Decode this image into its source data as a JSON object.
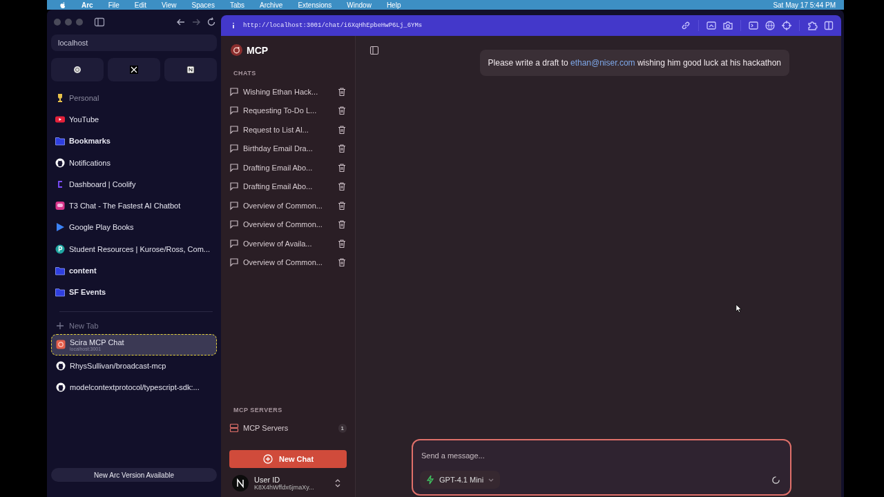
{
  "menu_bar": {
    "app": "Arc",
    "items": [
      "File",
      "Edit",
      "View",
      "Spaces",
      "Tabs",
      "Archive",
      "Extensions",
      "Window",
      "Help"
    ],
    "clock": "Sat May 17  5:44 PM"
  },
  "arc_sidebar": {
    "address": "localhost",
    "items": [
      {
        "kind": "space",
        "label": "Personal"
      },
      {
        "kind": "youtube",
        "label": "YouTube"
      },
      {
        "kind": "folder",
        "label": "Bookmarks"
      },
      {
        "kind": "github",
        "label": "Notifications"
      },
      {
        "kind": "coolify",
        "label": "Dashboard | Coolify"
      },
      {
        "kind": "t3",
        "label": "T3 Chat - The Fastest AI Chatbot"
      },
      {
        "kind": "play",
        "label": "Google Play Books"
      },
      {
        "kind": "pearson",
        "label": "Student Resources | Kurose/Ross, Com..."
      },
      {
        "kind": "folder",
        "label": "content"
      },
      {
        "kind": "folder",
        "label": "SF Events"
      }
    ],
    "new_tab": "New Tab",
    "tabs": [
      {
        "kind": "scira",
        "title": "Scira MCP Chat",
        "subtitle": "localhost:3001",
        "selected": true
      },
      {
        "kind": "github",
        "title": "RhysSullivan/broadcast-mcp",
        "selected": false
      },
      {
        "kind": "github",
        "title": "modelcontextprotocol/typescript-sdk:...",
        "selected": false
      }
    ],
    "update_banner": "New Arc Version Available"
  },
  "browser": {
    "url": "http://localhost:3001/chat/i6XqHhEpbeHwP6Lj_6YMs"
  },
  "app": {
    "brand": "MCP",
    "chats_heading": "CHATS",
    "chats": [
      "Wishing Ethan Hack...",
      "Requesting To-Do L...",
      "Request to List Al...",
      "Birthday Email Dra...",
      "Drafting Email Abo...",
      "Drafting Email Abo...",
      "Overview of Common...",
      "Overview of Common...",
      "Overview of Availa...",
      "Overview of Common..."
    ],
    "servers_heading": "MCP SERVERS",
    "servers": {
      "label": "MCP Servers",
      "count": "1"
    },
    "new_chat": "New Chat",
    "user": {
      "name": "User ID",
      "id": "K8X4hWffdx6jmaXy..."
    },
    "message": {
      "before": "Please write a draft to",
      "link": "ethan@niser.com",
      "after": "wishing him good luck at his hackathon"
    },
    "composer": {
      "placeholder": "Send a message...",
      "model": "GPT-4.1 Mini"
    }
  }
}
